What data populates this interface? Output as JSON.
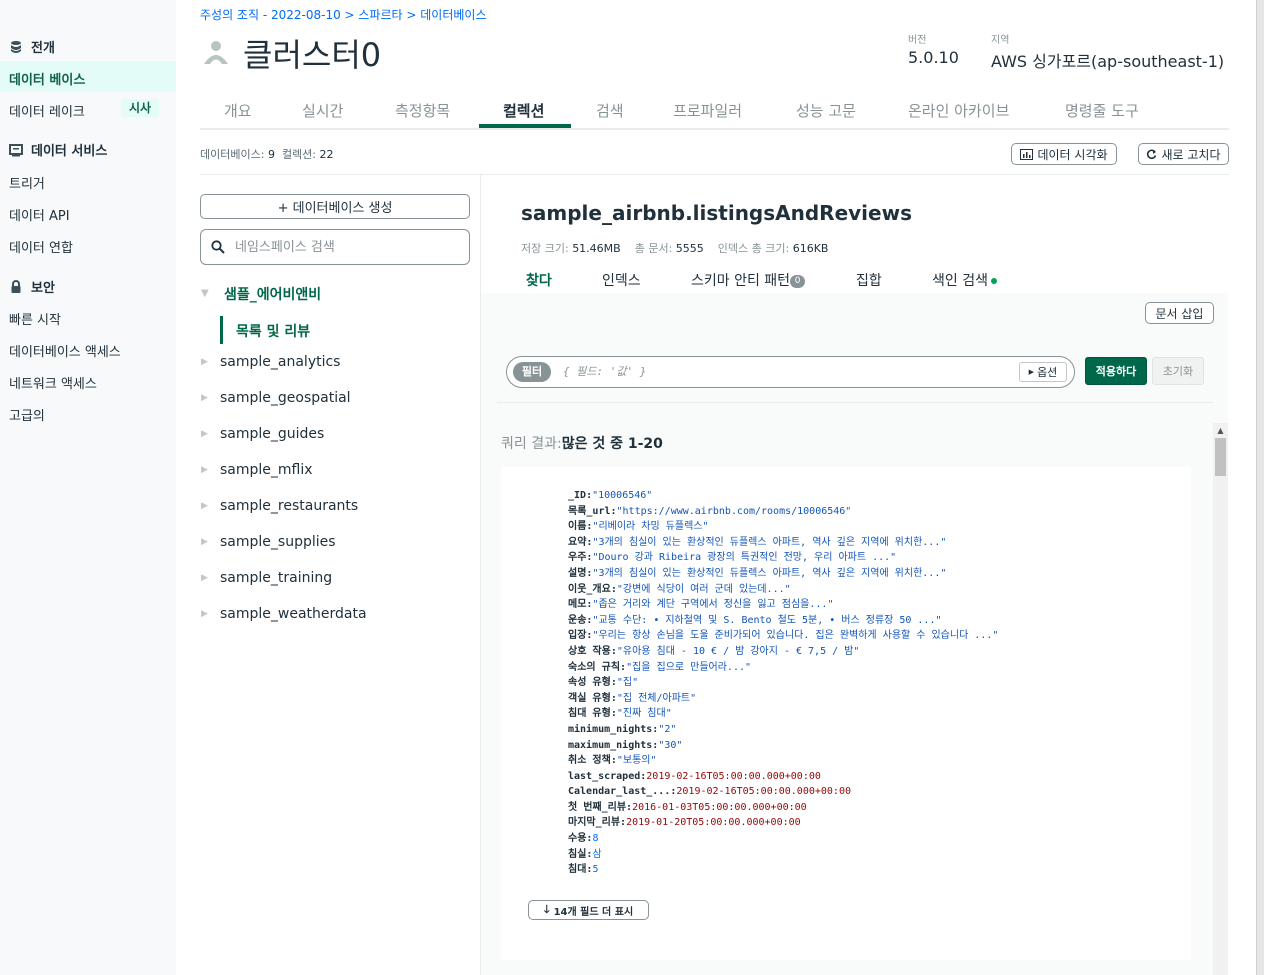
{
  "sidebar": {
    "sections": [
      {
        "title": "전개",
        "icon": "database-stack-icon"
      },
      {
        "title": "데이터 서비스",
        "icon": "data-services-icon"
      },
      {
        "title": "보안",
        "icon": "lock-icon"
      }
    ],
    "deploy_items": [
      "데이터 베이스",
      "데이터 레이크"
    ],
    "data_lake_badge": "시사",
    "service_items": [
      "트리거",
      "데이터 API",
      "데이터 연합"
    ],
    "security_items": [
      "빠른 시작",
      "데이터베이스 액세스",
      "네트워크 액세스",
      "고급의"
    ]
  },
  "header": {
    "breadcrumb": "주성의 조직 - 2022-08-10 > 스파르타 > 데이터베이스",
    "cluster_name": "클러스터0",
    "version_label": "버전",
    "version_value": "5.0.10",
    "region_label": "지역",
    "region_value": "AWS 싱가포르(ap-southeast-1)"
  },
  "tabs": [
    "개요",
    "실시간",
    "측정항목",
    "컬렉션",
    "검색",
    "프로파일러",
    "성능 고문",
    "온라인 아카이브",
    "명령줄 도구"
  ],
  "active_tab": "컬렉션",
  "counts": {
    "db_label": "데이터베이스:",
    "db_value": "9",
    "coll_label": "컬렉션:",
    "coll_value": "22"
  },
  "buttons": {
    "visualize": "데이터 시각화",
    "refresh": "새로 고치다",
    "create_db": "+ 데이터베이스 생성",
    "insert_doc": "문서 삽입",
    "apply": "적용하다",
    "reset": "초기화",
    "options": "옵션",
    "show_more": "14개 필드 더 표시"
  },
  "namespace": {
    "search_placeholder": "네임스페이스 검색",
    "selected_db": "샘플_에어비앤비",
    "selected_collection": "목록 및 리뷰",
    "databases": [
      "sample_analytics",
      "sample_geospatial",
      "sample_guides",
      "sample_mflix",
      "sample_restaurants",
      "sample_supplies",
      "sample_training",
      "sample_weatherdata"
    ]
  },
  "collection": {
    "title": "sample_airbnb.listingsAndReviews",
    "storage_label": "저장 크기:",
    "storage_value": "51.46MB",
    "docs_label": "총 문서:",
    "docs_value": "5555",
    "index_label": "인덱스 총 크기:",
    "index_value": "616KB",
    "tabs": [
      "찾다",
      "인덱스",
      "스키마 안티 패턴",
      "집합",
      "색인 검색"
    ],
    "schema_badge": "0"
  },
  "filter": {
    "chip": "필터",
    "placeholder": "{ 필드: '값' }"
  },
  "query_result": {
    "label": "쿼리 결과:",
    "value": "많은 것 중 1-20"
  },
  "document": [
    {
      "k": "_ID",
      "v": "\"10006546\"",
      "t": "s"
    },
    {
      "k": "목록_url",
      "v": "\"https://www.airbnb.com/rooms/10006546\"",
      "t": "s"
    },
    {
      "k": "이름",
      "v": "\"리베이라 차밍 듀플렉스\"",
      "t": "s"
    },
    {
      "k": "요약",
      "v": "\"3개의 침실이 있는 환상적인 듀플렉스 아파트, 역사 깊은 지역에 위치한...\"",
      "t": "s"
    },
    {
      "k": "우주",
      "v": "\"Douro 강과 Ribeira 광장의 특권적인 전망, 우리 아파트 ...\"",
      "t": "s"
    },
    {
      "k": "설명",
      "v": "\"3개의 침실이 있는 환상적인 듀플렉스 아파트, 역사 깊은 지역에 위치한...\"",
      "t": "s"
    },
    {
      "k": "이웃_개요",
      "v": "\"강변에 식당이 여러 군데 있는데...\"",
      "t": "s"
    },
    {
      "k": "메모",
      "v": "\"좁은 거리와 계단 구역에서 정신을 잃고 점심을...\"",
      "t": "s"
    },
    {
      "k": "운송",
      "v": "\"교통 수단: • 지하철역 및 S. Bento 철도 5분, • 버스 정류장 50 ...\"",
      "t": "s"
    },
    {
      "k": "입장",
      "v": "\"우리는 항상 손님을 도울 준비가되어 있습니다. 집은 완벽하게 사용할 수 있습니다 ...\"",
      "t": "s"
    },
    {
      "k": "상호 작용",
      "v": "\"유아용 침대 - 10 € / 밤 강아지 - € 7,5 / 밤\"",
      "t": "s"
    },
    {
      "k": "숙소의 규칙",
      "v": "\"집을 집으로 만들어라...\"",
      "t": "s"
    },
    {
      "k": "속성 유형",
      "v": "\"집\"",
      "t": "s"
    },
    {
      "k": "객실 유형",
      "v": "\"집 전체/아파트\"",
      "t": "s"
    },
    {
      "k": "침대 유형",
      "v": "\"진짜 침대\"",
      "t": "s"
    },
    {
      "k": "minimum_nights",
      "v": "\"2\"",
      "t": "s"
    },
    {
      "k": "maximum_nights",
      "v": "\"30\"",
      "t": "s"
    },
    {
      "k": "취소 정책",
      "v": "\"보통의\"",
      "t": "s"
    },
    {
      "k": "last_scraped",
      "v": "2019-02-16T05:00:00.000+00:00",
      "t": "d"
    },
    {
      "k": "Calendar_last_...",
      "v": "2019-02-16T05:00:00.000+00:00",
      "t": "d"
    },
    {
      "k": "첫 번째_리뷰",
      "v": "2016-01-03T05:00:00.000+00:00",
      "t": "d"
    },
    {
      "k": "마지막_리뷰",
      "v": "2019-01-20T05:00:00.000+00:00",
      "t": "d"
    },
    {
      "k": "수용",
      "v": "8",
      "t": "n"
    },
    {
      "k": "침실",
      "v": "삼",
      "t": "n"
    },
    {
      "k": "침대",
      "v": "5",
      "t": "n"
    }
  ],
  "colors": {
    "accent": "#00684a",
    "link": "#016bf8",
    "string": "#1254b7",
    "date": "#970606"
  }
}
